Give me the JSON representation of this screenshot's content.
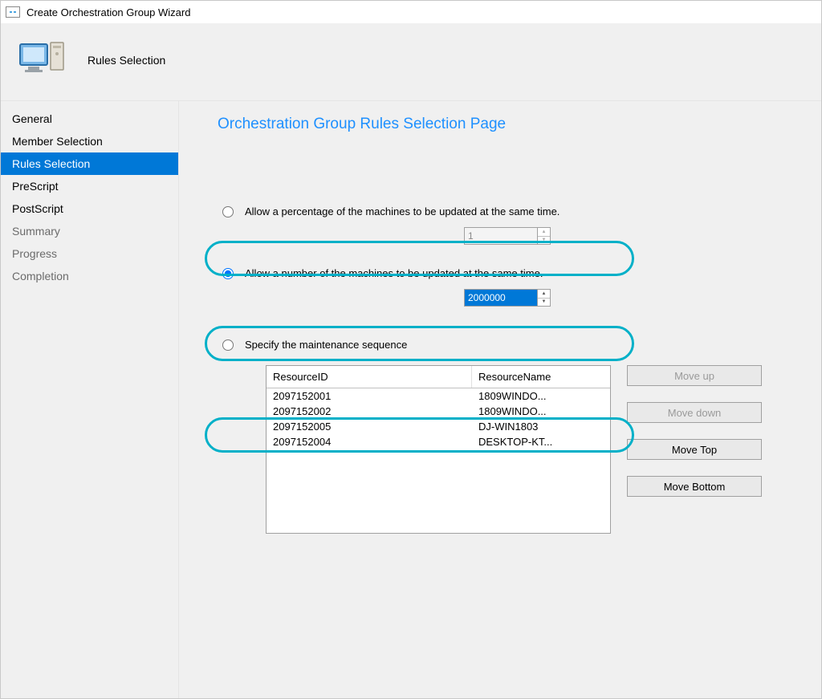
{
  "window": {
    "title": "Create Orchestration Group Wizard"
  },
  "header": {
    "step_label": "Rules Selection"
  },
  "sidebar": {
    "items": [
      {
        "label": "General",
        "state": "normal"
      },
      {
        "label": "Member Selection",
        "state": "normal"
      },
      {
        "label": "Rules Selection",
        "state": "selected"
      },
      {
        "label": "PreScript",
        "state": "normal"
      },
      {
        "label": "PostScript",
        "state": "normal"
      },
      {
        "label": "Summary",
        "state": "dim"
      },
      {
        "label": "Progress",
        "state": "dim"
      },
      {
        "label": "Completion",
        "state": "dim"
      }
    ]
  },
  "main": {
    "page_title": "Orchestration Group Rules Selection Page",
    "options": {
      "percent": {
        "label": "Allow a percentage of the machines to be updated at the same time.",
        "value": "1",
        "selected": false
      },
      "number": {
        "label": "Allow a number of the machines to be updated at the same time.",
        "value": "2000000",
        "selected": true
      },
      "sequence": {
        "label": "Specify the maintenance sequence",
        "selected": false
      }
    },
    "table": {
      "columns": {
        "id": "ResourceID",
        "name": "ResourceName"
      },
      "rows": [
        {
          "id": "2097152001",
          "name": "1809WINDO..."
        },
        {
          "id": "2097152002",
          "name": "1809WINDO..."
        },
        {
          "id": "2097152005",
          "name": "DJ-WIN1803"
        },
        {
          "id": "2097152004",
          "name": "DESKTOP-KT..."
        }
      ]
    },
    "buttons": {
      "move_up": {
        "label": "Move up",
        "enabled": false
      },
      "move_down": {
        "label": "Move down",
        "enabled": false
      },
      "move_top": {
        "label": "Move Top",
        "enabled": true
      },
      "move_bottom": {
        "label": "Move Bottom",
        "enabled": true
      }
    }
  }
}
